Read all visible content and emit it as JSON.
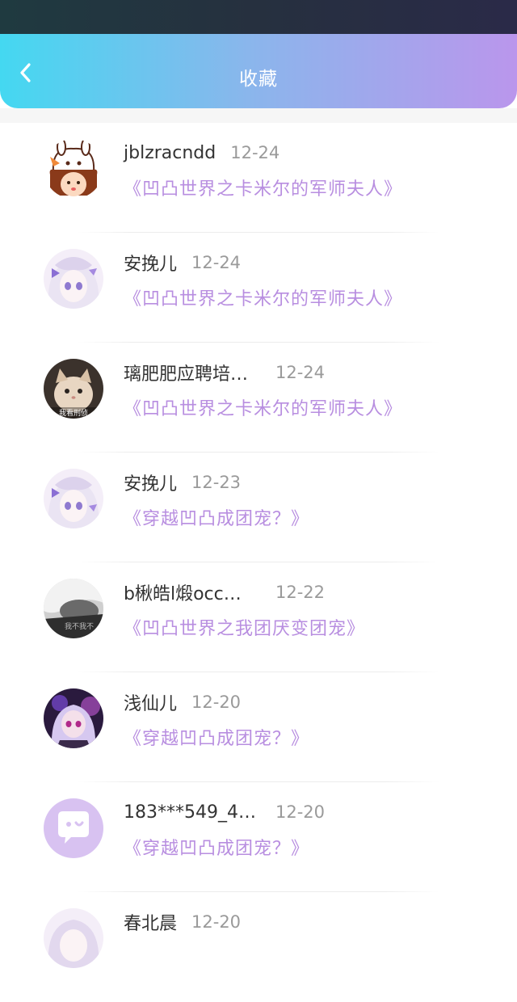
{
  "header": {
    "title": "收藏"
  },
  "items": [
    {
      "name": "jblzracndd",
      "date": "12-24",
      "book": "《凹凸世界之卡米尔的军师夫人》"
    },
    {
      "name": "安挽儿",
      "date": "12-24",
      "book": "《凹凸世界之卡米尔的军师夫人》"
    },
    {
      "name": "璃肥肥应聘培…",
      "date": "12-24",
      "book": "《凹凸世界之卡米尔的军师夫人》",
      "avatar_text": "我看刑侦"
    },
    {
      "name": "安挽儿",
      "date": "12-23",
      "book": "《穿越凹凸成团宠？》"
    },
    {
      "name": "b楸皓l煅occ…",
      "date": "12-22",
      "book": "《凹凸世界之我团厌变团宠》",
      "avatar_text": "我不我不"
    },
    {
      "name": "浅仙儿",
      "date": "12-20",
      "book": "《穿越凹凸成团宠？》"
    },
    {
      "name": "183***549_4…",
      "date": "12-20",
      "book": "《穿越凹凸成团宠？》"
    },
    {
      "name": "春北晨",
      "date": "12-20",
      "book": ""
    }
  ],
  "colors": {
    "accent_start": "#44d8f1",
    "accent_end": "#ba96ec",
    "book_title": "#b88ee0"
  }
}
